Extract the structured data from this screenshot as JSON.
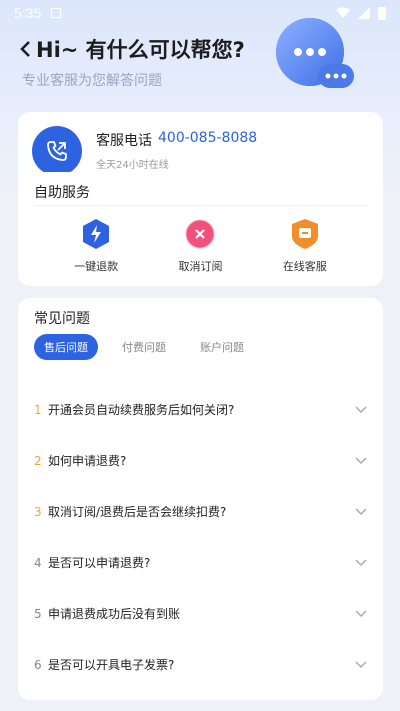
{
  "status_bar": {
    "time": "5:35"
  },
  "header": {
    "title": "Hi~ 有什么可以帮您?",
    "subtitle": "专业客服为您解答问题"
  },
  "phone_card": {
    "label": "客服电话",
    "number": "400-085-8088",
    "hours": "全天24小时在线"
  },
  "self_service": {
    "title": "自助服务",
    "items": [
      {
        "label": "一键退款",
        "icon": "lightning-shield-icon",
        "color": "#2d63e0"
      },
      {
        "label": "取消订阅",
        "icon": "cancel-subscription-icon",
        "color": "#f0527d"
      },
      {
        "label": "在线客服",
        "icon": "online-service-icon",
        "color": "#f28d2c"
      }
    ]
  },
  "faq": {
    "title": "常见问题",
    "tabs": [
      "售后问题",
      "付费问题",
      "账户问题"
    ],
    "active_tab": "售后问题",
    "items": [
      {
        "num": "1",
        "question": "开通会员自动续费服务后如何关闭?"
      },
      {
        "num": "2",
        "question": "如何申请退费?"
      },
      {
        "num": "3",
        "question": "取消订阅/退费后是否会继续扣费?"
      },
      {
        "num": "4",
        "question": "是否可以申请退费?"
      },
      {
        "num": "5",
        "question": "申请退费成功后没有到账"
      },
      {
        "num": "6",
        "question": "是否可以开具电子发票?"
      }
    ]
  }
}
